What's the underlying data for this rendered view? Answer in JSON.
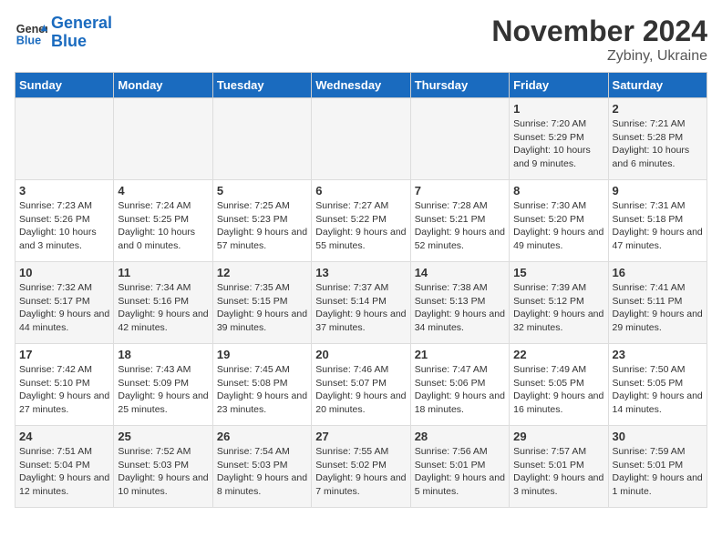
{
  "header": {
    "logo_text_general": "General",
    "logo_text_blue": "Blue",
    "month": "November 2024",
    "location": "Zybiny, Ukraine"
  },
  "weekdays": [
    "Sunday",
    "Monday",
    "Tuesday",
    "Wednesday",
    "Thursday",
    "Friday",
    "Saturday"
  ],
  "weeks": [
    [
      {
        "day": "",
        "info": ""
      },
      {
        "day": "",
        "info": ""
      },
      {
        "day": "",
        "info": ""
      },
      {
        "day": "",
        "info": ""
      },
      {
        "day": "",
        "info": ""
      },
      {
        "day": "1",
        "info": "Sunrise: 7:20 AM\nSunset: 5:29 PM\nDaylight: 10 hours and 9 minutes."
      },
      {
        "day": "2",
        "info": "Sunrise: 7:21 AM\nSunset: 5:28 PM\nDaylight: 10 hours and 6 minutes."
      }
    ],
    [
      {
        "day": "3",
        "info": "Sunrise: 7:23 AM\nSunset: 5:26 PM\nDaylight: 10 hours and 3 minutes."
      },
      {
        "day": "4",
        "info": "Sunrise: 7:24 AM\nSunset: 5:25 PM\nDaylight: 10 hours and 0 minutes."
      },
      {
        "day": "5",
        "info": "Sunrise: 7:25 AM\nSunset: 5:23 PM\nDaylight: 9 hours and 57 minutes."
      },
      {
        "day": "6",
        "info": "Sunrise: 7:27 AM\nSunset: 5:22 PM\nDaylight: 9 hours and 55 minutes."
      },
      {
        "day": "7",
        "info": "Sunrise: 7:28 AM\nSunset: 5:21 PM\nDaylight: 9 hours and 52 minutes."
      },
      {
        "day": "8",
        "info": "Sunrise: 7:30 AM\nSunset: 5:20 PM\nDaylight: 9 hours and 49 minutes."
      },
      {
        "day": "9",
        "info": "Sunrise: 7:31 AM\nSunset: 5:18 PM\nDaylight: 9 hours and 47 minutes."
      }
    ],
    [
      {
        "day": "10",
        "info": "Sunrise: 7:32 AM\nSunset: 5:17 PM\nDaylight: 9 hours and 44 minutes."
      },
      {
        "day": "11",
        "info": "Sunrise: 7:34 AM\nSunset: 5:16 PM\nDaylight: 9 hours and 42 minutes."
      },
      {
        "day": "12",
        "info": "Sunrise: 7:35 AM\nSunset: 5:15 PM\nDaylight: 9 hours and 39 minutes."
      },
      {
        "day": "13",
        "info": "Sunrise: 7:37 AM\nSunset: 5:14 PM\nDaylight: 9 hours and 37 minutes."
      },
      {
        "day": "14",
        "info": "Sunrise: 7:38 AM\nSunset: 5:13 PM\nDaylight: 9 hours and 34 minutes."
      },
      {
        "day": "15",
        "info": "Sunrise: 7:39 AM\nSunset: 5:12 PM\nDaylight: 9 hours and 32 minutes."
      },
      {
        "day": "16",
        "info": "Sunrise: 7:41 AM\nSunset: 5:11 PM\nDaylight: 9 hours and 29 minutes."
      }
    ],
    [
      {
        "day": "17",
        "info": "Sunrise: 7:42 AM\nSunset: 5:10 PM\nDaylight: 9 hours and 27 minutes."
      },
      {
        "day": "18",
        "info": "Sunrise: 7:43 AM\nSunset: 5:09 PM\nDaylight: 9 hours and 25 minutes."
      },
      {
        "day": "19",
        "info": "Sunrise: 7:45 AM\nSunset: 5:08 PM\nDaylight: 9 hours and 23 minutes."
      },
      {
        "day": "20",
        "info": "Sunrise: 7:46 AM\nSunset: 5:07 PM\nDaylight: 9 hours and 20 minutes."
      },
      {
        "day": "21",
        "info": "Sunrise: 7:47 AM\nSunset: 5:06 PM\nDaylight: 9 hours and 18 minutes."
      },
      {
        "day": "22",
        "info": "Sunrise: 7:49 AM\nSunset: 5:05 PM\nDaylight: 9 hours and 16 minutes."
      },
      {
        "day": "23",
        "info": "Sunrise: 7:50 AM\nSunset: 5:05 PM\nDaylight: 9 hours and 14 minutes."
      }
    ],
    [
      {
        "day": "24",
        "info": "Sunrise: 7:51 AM\nSunset: 5:04 PM\nDaylight: 9 hours and 12 minutes."
      },
      {
        "day": "25",
        "info": "Sunrise: 7:52 AM\nSunset: 5:03 PM\nDaylight: 9 hours and 10 minutes."
      },
      {
        "day": "26",
        "info": "Sunrise: 7:54 AM\nSunset: 5:03 PM\nDaylight: 9 hours and 8 minutes."
      },
      {
        "day": "27",
        "info": "Sunrise: 7:55 AM\nSunset: 5:02 PM\nDaylight: 9 hours and 7 minutes."
      },
      {
        "day": "28",
        "info": "Sunrise: 7:56 AM\nSunset: 5:01 PM\nDaylight: 9 hours and 5 minutes."
      },
      {
        "day": "29",
        "info": "Sunrise: 7:57 AM\nSunset: 5:01 PM\nDaylight: 9 hours and 3 minutes."
      },
      {
        "day": "30",
        "info": "Sunrise: 7:59 AM\nSunset: 5:01 PM\nDaylight: 9 hours and 1 minute."
      }
    ]
  ]
}
